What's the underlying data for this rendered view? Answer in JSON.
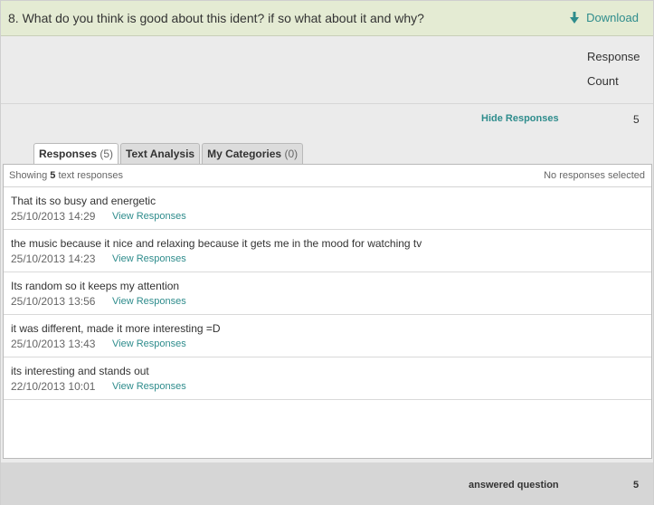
{
  "question": {
    "title": "8. What do you think is good about this ident? if so what about it and why?",
    "download_label": "Download"
  },
  "response_header": {
    "line1": "Response",
    "line2": "Count"
  },
  "summary": {
    "hide_label": "Hide Responses",
    "count": "5"
  },
  "tabs": [
    {
      "label": "Responses",
      "count": "(5)"
    },
    {
      "label": "Text Analysis",
      "count": ""
    },
    {
      "label": "My Categories",
      "count": "(0)"
    }
  ],
  "panel": {
    "showing_prefix": "Showing",
    "showing_count": "5",
    "showing_suffix": "text responses",
    "selected_text": "No responses selected"
  },
  "responses": [
    {
      "text": "That its so busy and energetic",
      "date": "25/10/2013 14:29",
      "view": "View Responses"
    },
    {
      "text": "the music because it nice and relaxing because it gets me in the mood for watching tv",
      "date": "25/10/2013 14:23",
      "view": "View Responses"
    },
    {
      "text": "Its random so it keeps my attention",
      "date": "25/10/2013 13:56",
      "view": "View Responses"
    },
    {
      "text": "it was different, made it more interesting =D",
      "date": "25/10/2013 13:43",
      "view": "View Responses"
    },
    {
      "text": "its interesting and stands out",
      "date": "22/10/2013 10:01",
      "view": "View Responses"
    }
  ],
  "footer": {
    "answered_label": "answered question",
    "answered_count": "5"
  },
  "colors": {
    "header_bg": "#e4ebd3",
    "accent": "#2e8c8c"
  }
}
